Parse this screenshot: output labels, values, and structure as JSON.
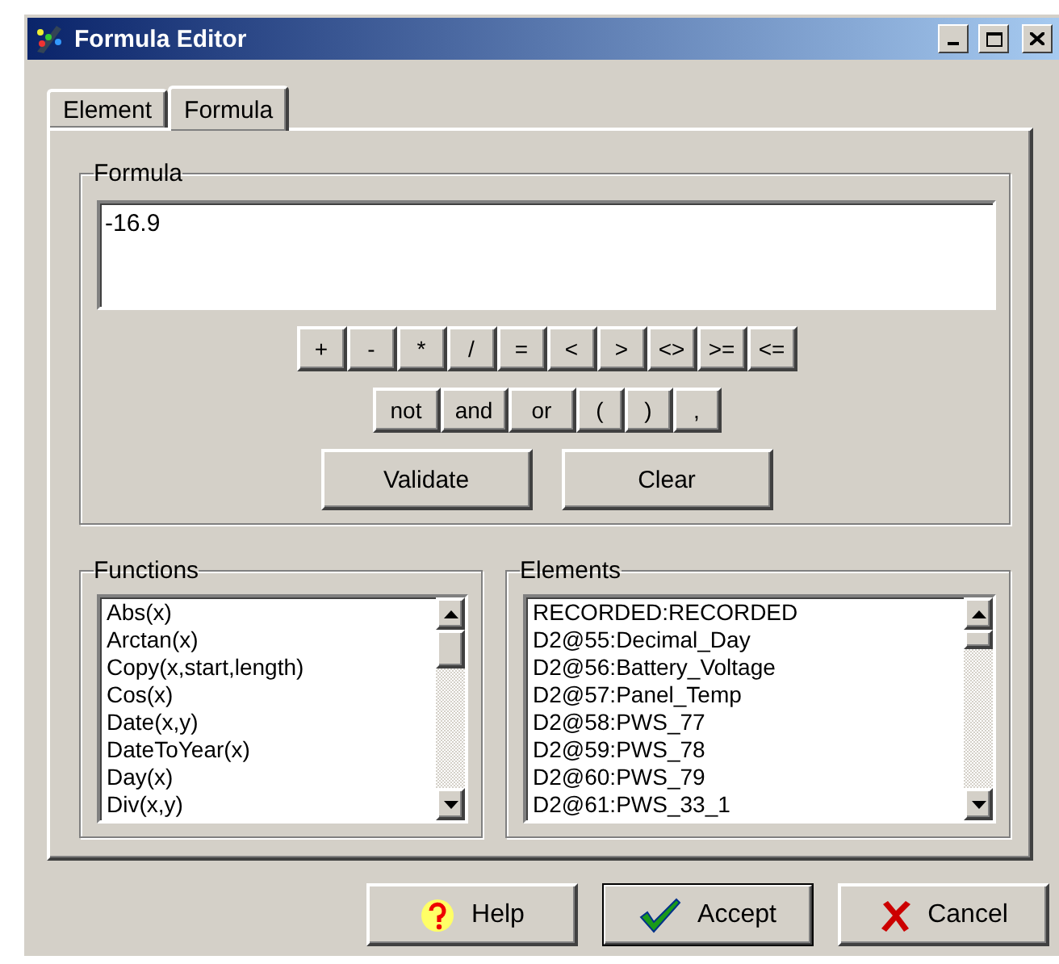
{
  "window": {
    "title": "Formula Editor"
  },
  "tabs": [
    {
      "label": "Element",
      "selected": false
    },
    {
      "label": "Formula",
      "selected": true
    }
  ],
  "formula_group": {
    "title": "Formula",
    "value": "-16.9",
    "operators": [
      "+",
      "-",
      "*",
      "/",
      "=",
      "<",
      ">",
      "<>",
      ">=",
      "<="
    ],
    "logic": [
      "not",
      "and",
      "or",
      "(",
      ")",
      ","
    ],
    "actions": [
      "Validate",
      "Clear"
    ]
  },
  "functions": {
    "title": "Functions",
    "items": [
      "Abs(x)",
      "Arctan(x)",
      "Copy(x,start,length)",
      "Cos(x)",
      "Date(x,y)",
      "DateToYear(x)",
      "Day(x)",
      "Div(x,y)"
    ]
  },
  "elements": {
    "title": "Elements",
    "items": [
      "RECORDED:RECORDED",
      "D2@55:Decimal_Day",
      "D2@56:Battery_Voltage",
      "D2@57:Panel_Temp",
      "D2@58:PWS_77",
      "D2@59:PWS_78",
      "D2@60:PWS_79",
      "D2@61:PWS_33_1"
    ]
  },
  "buttons": [
    {
      "kind": "help",
      "label": "Help"
    },
    {
      "kind": "accept",
      "label": "Accept"
    },
    {
      "kind": "cancel",
      "label": "Cancel"
    }
  ]
}
